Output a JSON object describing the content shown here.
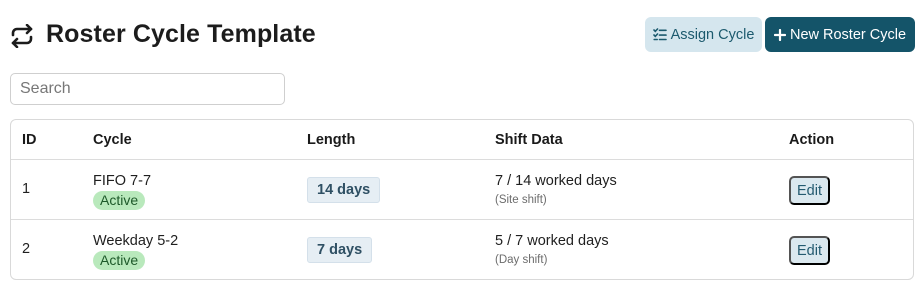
{
  "header": {
    "title": "Roster Cycle Template",
    "title_icon": "repeat-icon",
    "assign_button": {
      "label": "Assign Cycle",
      "icon": "checklist-icon"
    },
    "new_button": {
      "label": "New Roster Cycle",
      "icon": "plus-icon"
    }
  },
  "search": {
    "placeholder": "Search",
    "value": ""
  },
  "table": {
    "columns": [
      "ID",
      "Cycle",
      "Length",
      "Shift Data",
      "Action"
    ],
    "rows": [
      {
        "id": "1",
        "cycle": "FIFO 7-7",
        "status": "Active",
        "length": "14 days",
        "shift_main": "7 / 14 worked days",
        "shift_sub": "(Site shift)",
        "action": "Edit"
      },
      {
        "id": "2",
        "cycle": "Weekday 5-2",
        "status": "Active",
        "length": "7 days",
        "shift_main": "5 / 7 worked days",
        "shift_sub": "(Day shift)",
        "action": "Edit"
      }
    ]
  },
  "colors": {
    "primary": "#145469",
    "secondary_button": "#d5e6ee",
    "status_active": "#b9e9bc",
    "length_badge": "#e6eef4"
  }
}
